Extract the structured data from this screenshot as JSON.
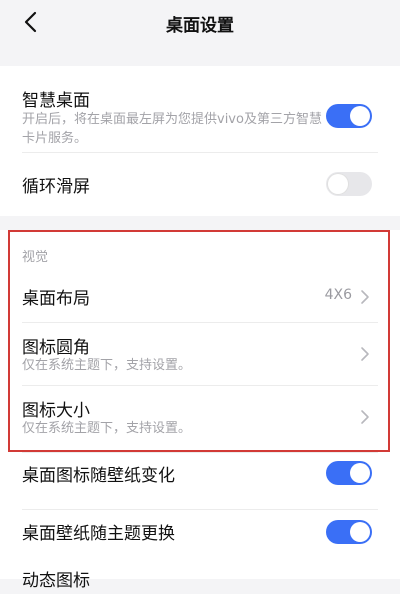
{
  "header": {
    "title": "桌面设置"
  },
  "icons": {
    "back": "chevron-left-icon",
    "chevron": "chevron-right-icon"
  },
  "settings": {
    "smart_desktop": {
      "label": "智慧桌面",
      "desc": "开启后，将在桌面最左屏为您提供vivo及第三方智慧卡片服务。",
      "toggle": "on"
    },
    "loop_scroll": {
      "label": "循环滑屏",
      "toggle": "off"
    }
  },
  "visual": {
    "section_label": "视觉",
    "layout": {
      "label": "桌面布局",
      "value": "4X6"
    },
    "icon_corner": {
      "label": "图标圆角",
      "desc": "仅在系统主题下，支持设置。"
    },
    "icon_size": {
      "label": "图标大小",
      "desc": "仅在系统主题下，支持设置。"
    }
  },
  "more": {
    "icon_follow_wallpaper": {
      "label": "桌面图标随壁纸变化",
      "toggle": "on"
    },
    "wallpaper_follow_theme": {
      "label": "桌面壁纸随主题更换",
      "toggle": "on"
    },
    "dynamic_icon": {
      "label": "动态图标"
    }
  },
  "colors": {
    "accent": "#3a6ff6",
    "highlight_border": "#d23a36"
  }
}
